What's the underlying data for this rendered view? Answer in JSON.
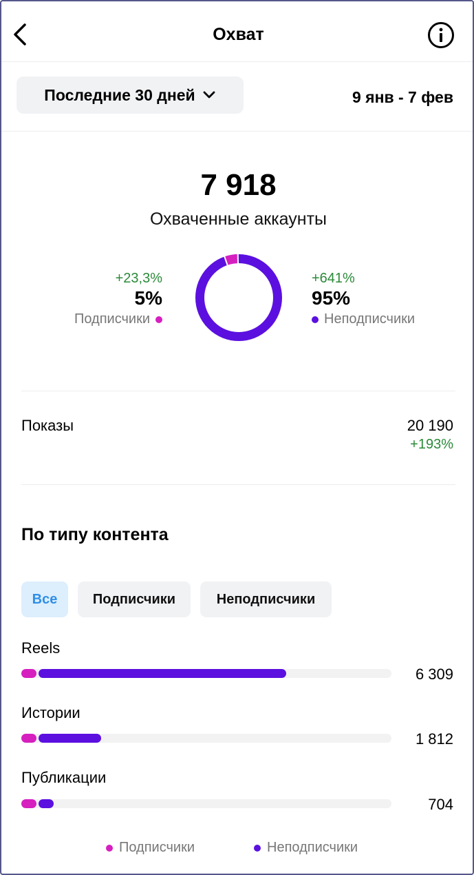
{
  "header": {
    "title": "Охват",
    "back_icon": "chevron-left-icon",
    "info_icon": "info-icon"
  },
  "filter": {
    "period_label": "Последние 30 дней",
    "date_range": "9 янв - 7 фев"
  },
  "reach": {
    "total": "7 918",
    "label": "Охваченные аккаунты",
    "followers": {
      "change": "+23,3%",
      "percent": "5%",
      "label": "Подписчики",
      "share": 0.05
    },
    "non_followers": {
      "change": "+641%",
      "percent": "95%",
      "label": "Неподписчики",
      "share": 0.95
    }
  },
  "impressions": {
    "label": "Показы",
    "value": "20 190",
    "change": "+193%"
  },
  "content_type": {
    "title": "По типу контента",
    "tabs": [
      {
        "label": "Все",
        "active": true
      },
      {
        "label": "Подписчики",
        "active": false
      },
      {
        "label": "Неподписчики",
        "active": false
      }
    ],
    "items": [
      {
        "label": "Reels",
        "value": "6 309",
        "followers_share": 0.04,
        "non_followers_share": 0.67
      },
      {
        "label": "Истории",
        "value": "1 812",
        "followers_share": 0.04,
        "non_followers_share": 0.17
      },
      {
        "label": "Публикации",
        "value": "704",
        "followers_share": 0.04,
        "non_followers_share": 0.04
      }
    ]
  },
  "legend": {
    "followers": "Подписчики",
    "non_followers": "Неподписчики"
  },
  "colors": {
    "followers": "#d61fbf",
    "non_followers": "#5b10e0",
    "positive": "#2a8a38",
    "active_tab_text": "#2f8fe6"
  }
}
